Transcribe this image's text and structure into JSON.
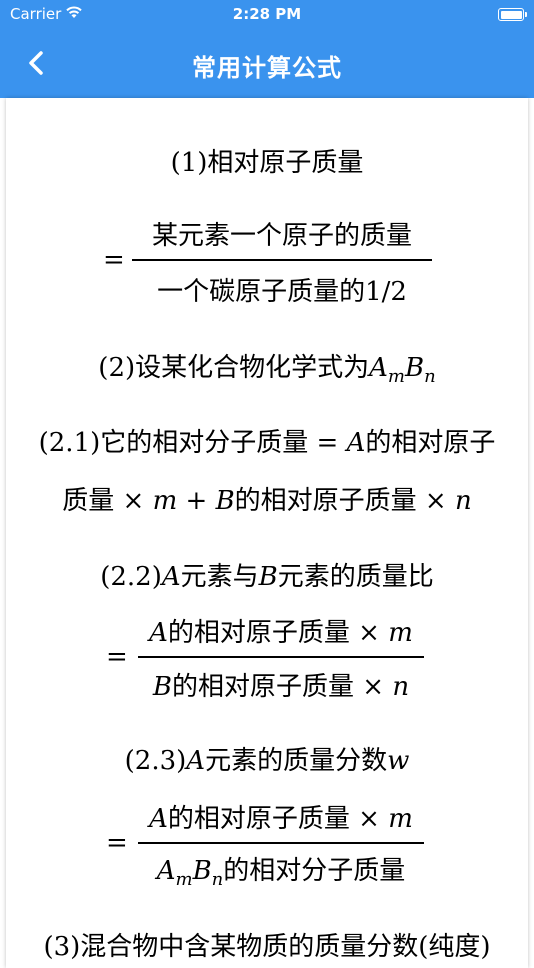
{
  "status_bar": {
    "carrier": "Carrier",
    "time": "2:28 PM"
  },
  "nav": {
    "title": "常用计算公式"
  },
  "formulas": {
    "f1_title": "(1)相对原子质量",
    "f1_eq": "=",
    "f1_num": "某元素一个原子的质量",
    "f1_den": "一个碳原子质量的1/2",
    "f2_title_prefix": "(2)设某化合物化学式为",
    "var_A": "A",
    "var_B": "B",
    "var_m": "m",
    "var_n": "n",
    "var_w": "w",
    "f21_line1_prefix": "(2.1)它的相对分子质量 = ",
    "f21_line1_suffix": "的相对原子",
    "f21_line2_prefix": "质量 × ",
    "f21_line2_mid": " + ",
    "f21_line2_suffix": "的相对原子质量 × ",
    "f22_title_prefix": "(2.2)",
    "f22_title_mid": "元素与",
    "f22_title_suffix": "元素的质量比",
    "f22_eq": "=",
    "f22_num_text": "的相对原子质量 × ",
    "f22_den_text": "的相对原子质量 × ",
    "f23_title_prefix": "(2.3)",
    "f23_title_suffix": "元素的质量分数",
    "f23_eq": "=",
    "f23_num_text": "的相对原子质量 × ",
    "f23_den_text": "的相对分子质量",
    "f3_title": "(3)混合物中含某物质的质量分数(纯度)"
  }
}
